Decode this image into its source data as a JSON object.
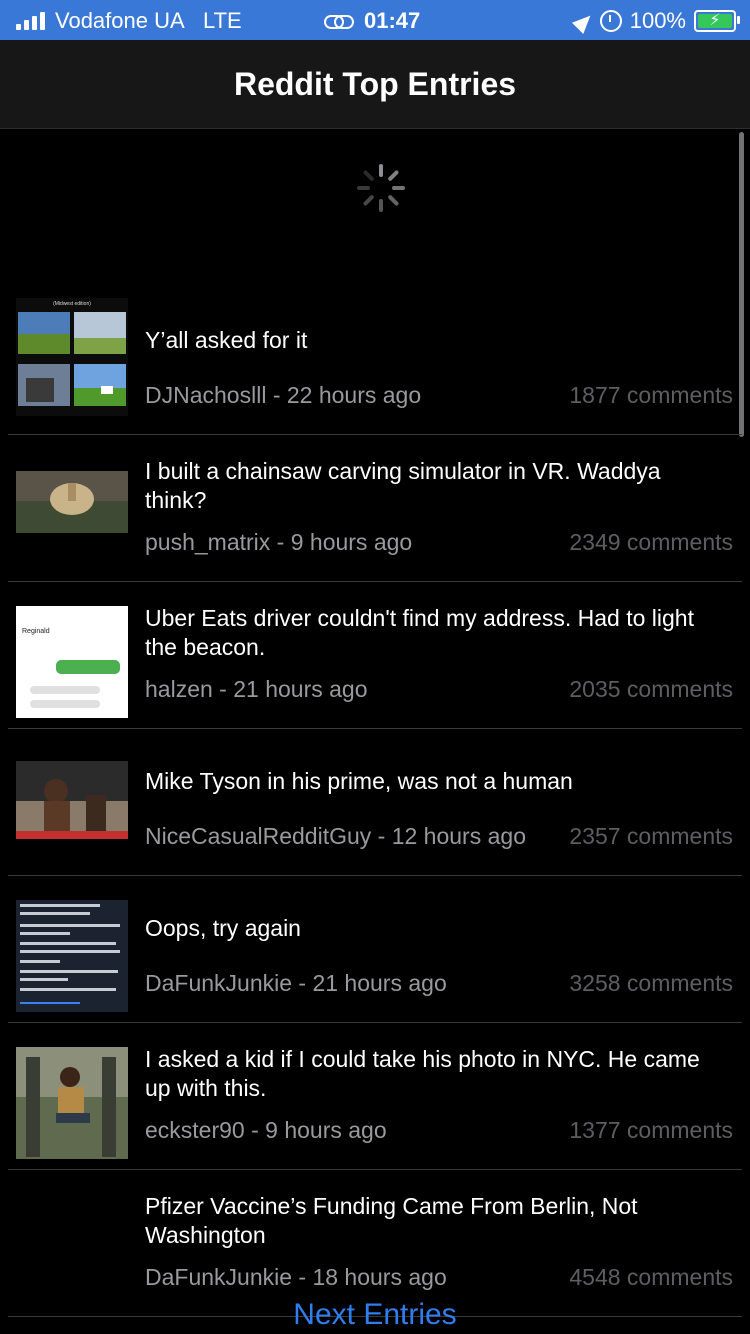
{
  "status_bar": {
    "carrier": "Vodafone UA",
    "network": "LTE",
    "time": "01:47",
    "battery": "100%",
    "icons": [
      "signal-icon",
      "link-icon",
      "location-icon",
      "alarm-icon",
      "battery-charging-icon"
    ]
  },
  "nav": {
    "title": "Reddit Top Entries"
  },
  "entries": [
    {
      "title": "Y’all asked for it",
      "author": "DJNachoslll",
      "time": "22 hours ago",
      "meta": "DJNachoslll - 22 hours ago",
      "comments": "1877 comments",
      "thumb_label": "(Midwest edition)"
    },
    {
      "title": "I built a chainsaw carving simulator in VR. Waddya think?",
      "author": "push_matrix",
      "time": "9 hours ago",
      "meta": "push_matrix - 9 hours ago",
      "comments": "2349 comments"
    },
    {
      "title": "Uber Eats driver couldn't find my address. Had to light the beacon.",
      "author": "halzen",
      "time": "21 hours ago",
      "meta": "halzen - 21 hours ago",
      "comments": "2035 comments",
      "thumb_label": "Reginald"
    },
    {
      "title": "Mike Tyson in his prime, was not a human",
      "author": "NiceCasualRedditGuy",
      "time": "12 hours ago",
      "meta": "NiceCasualRedditGuy - 12 hours ago",
      "comments": "2357 comments"
    },
    {
      "title": "Oops, try again",
      "author": "DaFunkJunkie",
      "time": "21 hours ago",
      "meta": "DaFunkJunkie - 21 hours ago",
      "comments": "3258 comments"
    },
    {
      "title": "I asked a kid if I could take his photo in NYC. He came up with this.",
      "author": "eckster90",
      "time": "9 hours ago",
      "meta": "eckster90 - 9 hours ago",
      "comments": "1377 comments"
    },
    {
      "title": "Pfizer Vaccine’s Funding Came From Berlin, Not Washington",
      "author": "DaFunkJunkie",
      "time": "18 hours ago",
      "meta": "DaFunkJunkie - 18 hours ago",
      "comments": "4548 comments"
    }
  ],
  "footer": {
    "next_label": "Next Entries"
  },
  "colors": {
    "status_bar": "#3a78d8",
    "nav_bg": "#171717",
    "accent": "#2f7ef0",
    "background": "#000000"
  }
}
